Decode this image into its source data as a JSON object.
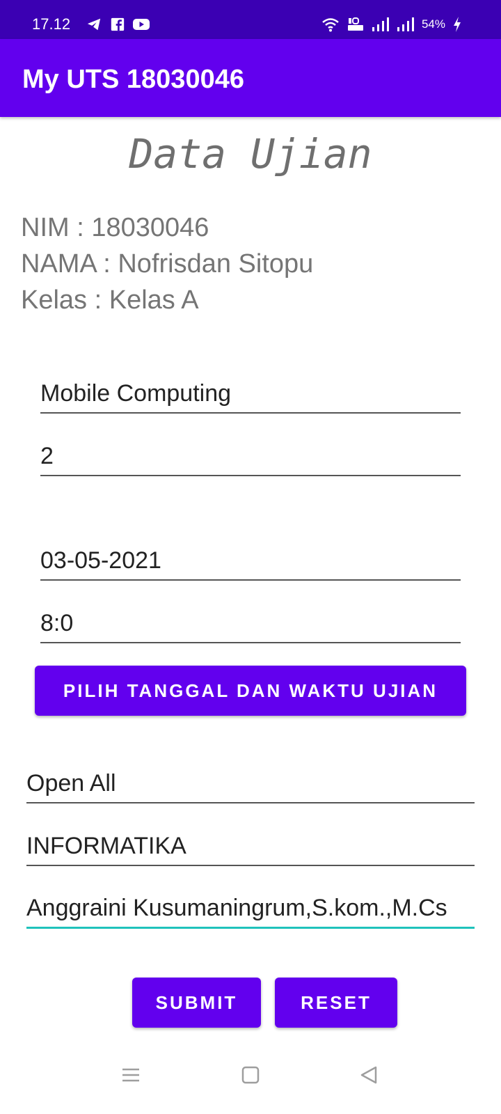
{
  "status_bar": {
    "time": "17.12",
    "battery": "54%",
    "left_icons": [
      "telegram-icon",
      "facebook-icon",
      "youtube-icon"
    ],
    "right_icons": [
      "wifi-icon",
      "volte-icon",
      "signal-icon",
      "signal-icon",
      "battery-charging-icon"
    ]
  },
  "app_bar": {
    "title": "My UTS 18030046"
  },
  "heading": "Data Ujian",
  "info": {
    "nim": "NIM : 18030046",
    "nama": "NAMA : Nofrisdan Sitopu",
    "kelas": "Kelas : Kelas A"
  },
  "form": {
    "mata_kuliah": "Mobile Computing",
    "sks": "2",
    "tanggal": "03-05-2021",
    "waktu": "8:0",
    "pilih_button": "PILIH TANGGAL DAN WAKTU UJIAN",
    "sifat": "Open All",
    "prodi": "INFORMATIKA",
    "dosen": "Anggraini Kusumaningrum,S.kom.,M.Cs"
  },
  "actions": {
    "submit": "SUBMIT",
    "reset": "RESET"
  },
  "nav_bar": {
    "icons": [
      "menu-icon",
      "home-square-icon",
      "back-triangle-icon"
    ]
  },
  "colors": {
    "status_bar": "#3b00b3",
    "primary": "#6200ee",
    "focus_accent": "#1fc2bb",
    "text_gray": "#757575"
  }
}
